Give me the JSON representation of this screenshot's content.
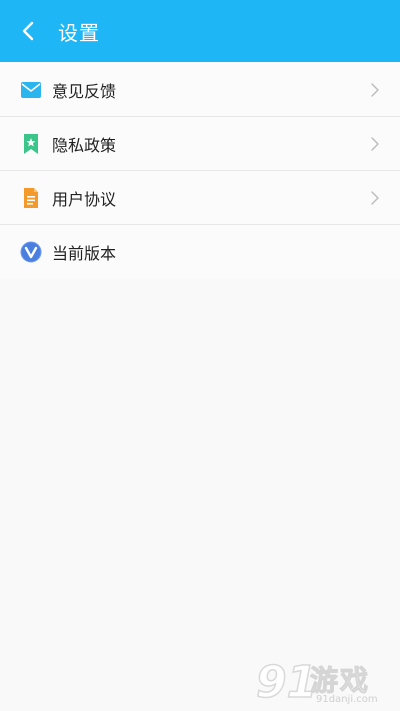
{
  "header": {
    "title": "设置",
    "background_color": "#1eb6f5"
  },
  "settings": {
    "items": [
      {
        "label": "意见反馈",
        "icon": "mail-icon",
        "has_chevron": true
      },
      {
        "label": "隐私政策",
        "icon": "bookmark-star-icon",
        "has_chevron": true
      },
      {
        "label": "用户协议",
        "icon": "document-icon",
        "has_chevron": true
      },
      {
        "label": "当前版本",
        "icon": "version-logo-icon",
        "has_chevron": false
      }
    ]
  },
  "watermark": {
    "number": "91",
    "text": "游戏",
    "url": "91danji.com"
  }
}
